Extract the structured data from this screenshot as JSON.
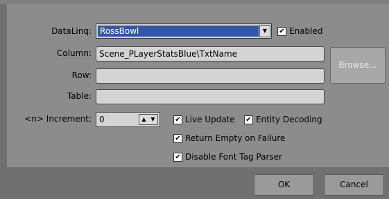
{
  "labels": {
    "dataling": "DataLinq:",
    "column": "Column:",
    "row": "Row:",
    "table": "Table:",
    "increment": "<n> Increment:"
  },
  "dataling": {
    "value": "RossBowl",
    "dropdown_icon": "chevron-down-icon"
  },
  "enabled": {
    "label": "Enabled",
    "checked": true
  },
  "column": {
    "value": "Scene_PLayerStatsBlue\\TxtName"
  },
  "row": {
    "value": ""
  },
  "table": {
    "value": ""
  },
  "browse": {
    "label": "Browse..."
  },
  "increment": {
    "value": "0"
  },
  "checkboxes": {
    "live_update": {
      "label": "Live Update",
      "checked": true
    },
    "entity_decoding": {
      "label": "Entity Decoding",
      "checked": true
    },
    "return_empty": {
      "label": "Return Empty on Failure",
      "checked": true
    },
    "disable_font": {
      "label": "Disable Font Tag Parser",
      "checked": true
    }
  },
  "buttons": {
    "ok": "OK",
    "cancel": "Cancel"
  }
}
